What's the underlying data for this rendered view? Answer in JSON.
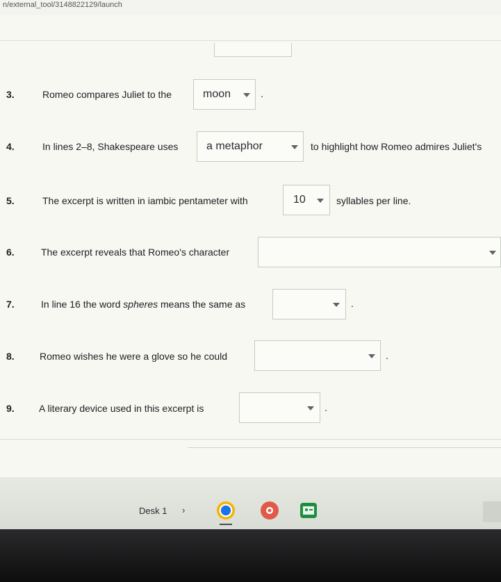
{
  "url": "n/external_tool/3148822129/launch",
  "questions": [
    {
      "num": "3.",
      "before": "Romeo compares Juliet to the",
      "dropdown": "moon",
      "after": "."
    },
    {
      "num": "4.",
      "before": "In lines 2–8, Shakespeare uses",
      "dropdown": "a metaphor",
      "after": "to highlight how Romeo admires Juliet's"
    },
    {
      "num": "5.",
      "before": "The excerpt is written in iambic pentameter with",
      "dropdown": "10",
      "after": "syllables per line."
    },
    {
      "num": "6.",
      "before": "The excerpt reveals that Romeo's character",
      "dropdown": "",
      "after": ""
    },
    {
      "num": "7.",
      "before_1": "In line 16 the word",
      "em": "spheres",
      "before_2": "means the same as",
      "dropdown": "",
      "after": "."
    },
    {
      "num": "8.",
      "before": "Romeo wishes he were a glove so he could",
      "dropdown": "",
      "after": "."
    },
    {
      "num": "9.",
      "before": "A literary device used in this excerpt is",
      "dropdown": "",
      "after": "."
    }
  ],
  "shelf": {
    "desk_label": "Desk 1",
    "arrow": "›",
    "icons": [
      "chrome-icon",
      "camera-app-icon",
      "classroom-app-icon"
    ]
  },
  "colors": {
    "chrome": "#1a73e8",
    "camera": "#e05a4a",
    "classroom": "#1e8e3e"
  }
}
